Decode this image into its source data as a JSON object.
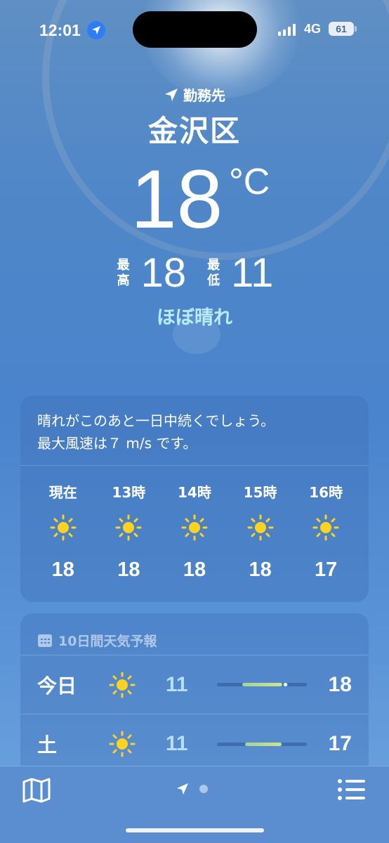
{
  "status": {
    "time": "12:01",
    "network": "4G",
    "battery": "61"
  },
  "location": {
    "label": "勤務先",
    "city": "金沢区"
  },
  "current": {
    "temp": "18",
    "unit": "°C",
    "high_label": "最高",
    "high": "18",
    "low_label": "最低",
    "low": "11",
    "condition": "ほぼ晴れ"
  },
  "hourly": {
    "summary_line1": "晴れがこのあと一日中続くでしょう。",
    "summary_line2": "最大風速は７ m/s です。",
    "items": [
      {
        "label": "現在",
        "icon": "sun-icon",
        "temp": "18"
      },
      {
        "label": "13時",
        "icon": "sun-icon",
        "temp": "18"
      },
      {
        "label": "14時",
        "icon": "sun-icon",
        "temp": "18"
      },
      {
        "label": "15時",
        "icon": "sun-icon",
        "temp": "18"
      },
      {
        "label": "16時",
        "icon": "sun-icon",
        "temp": "17"
      }
    ]
  },
  "forecast": {
    "title": "10日間天気予報",
    "days": [
      {
        "name": "今日",
        "icon": "sun-icon",
        "low": "11",
        "high": "18",
        "range_start": 0.28,
        "range_end": 0.73,
        "current_pos": 0.76
      },
      {
        "name": "土",
        "icon": "sun-icon",
        "low": "11",
        "high": "17",
        "range_start": 0.31,
        "range_end": 0.72
      }
    ]
  },
  "bottom_nav": {
    "map_icon": "map-icon",
    "location_icon": "location-arrow-icon",
    "list_icon": "list-icon"
  }
}
